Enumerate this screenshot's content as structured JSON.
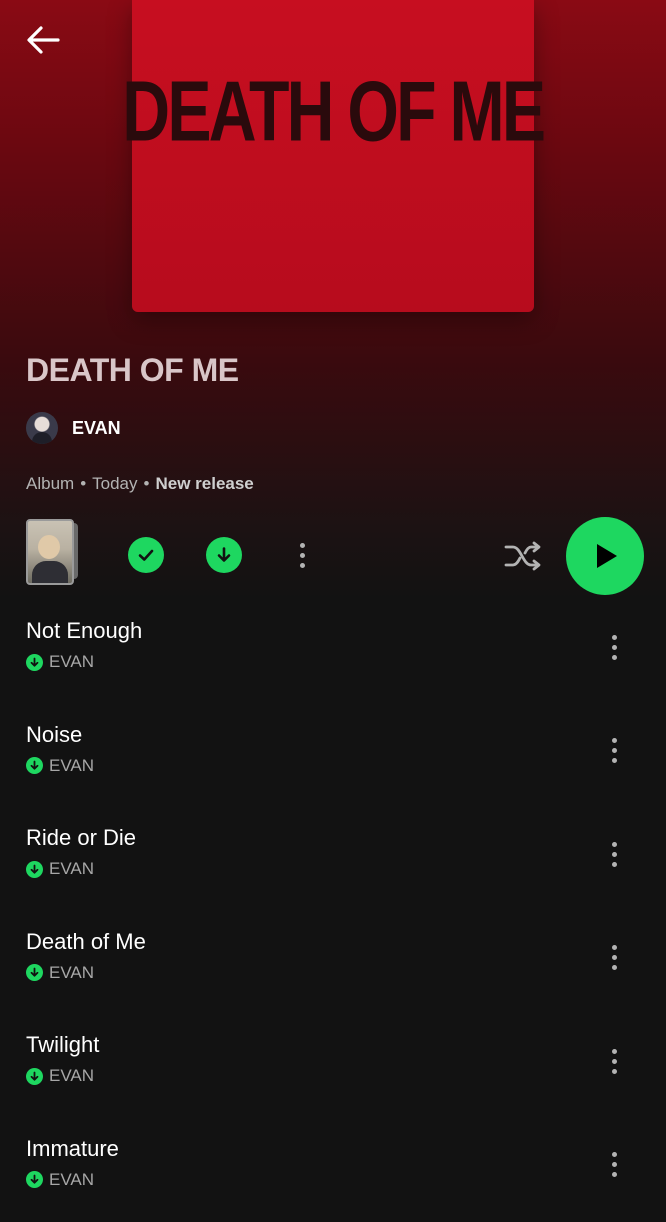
{
  "header": {
    "back_label": ""
  },
  "album": {
    "cover_text": "DEATH OF ME",
    "title": "DEATH OF ME",
    "artist": "EVAN",
    "meta": {
      "type": "Album",
      "sep1": "•",
      "date": "Today",
      "sep2": "•",
      "status": "New release"
    }
  },
  "colors": {
    "accent": "#1ed760",
    "background": "#121212",
    "cover": "#c70e20"
  },
  "controls": {
    "icons": [
      "arrow-left-icon",
      "check-icon",
      "download-icon",
      "more-vertical-icon",
      "shuffle-icon",
      "play-icon"
    ]
  },
  "tracks": [
    {
      "title": "Not Enough",
      "artist": "EVAN"
    },
    {
      "title": "Noise",
      "artist": "EVAN"
    },
    {
      "title": "Ride or Die",
      "artist": "EVAN"
    },
    {
      "title": "Death of Me",
      "artist": "EVAN"
    },
    {
      "title": "Twilight",
      "artist": "EVAN"
    },
    {
      "title": "Immature",
      "artist": "EVAN"
    }
  ]
}
